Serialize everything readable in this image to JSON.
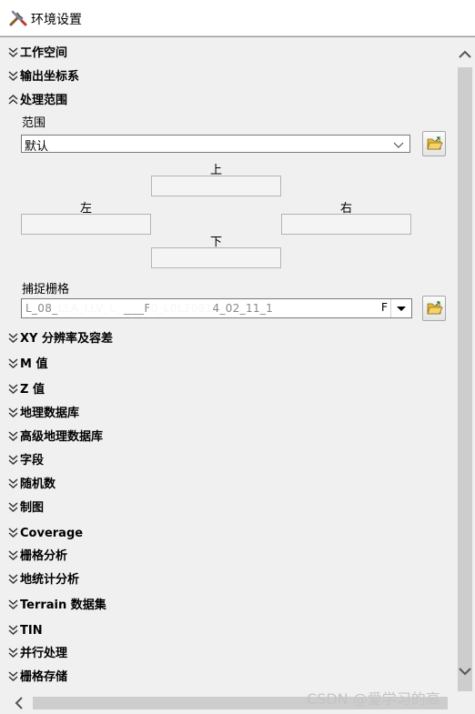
{
  "window": {
    "title": "环境设置"
  },
  "sections_top": [
    {
      "label": "工作空间",
      "expanded": false
    },
    {
      "label": "输出坐标系",
      "expanded": false
    },
    {
      "label": "处理范围",
      "expanded": true
    }
  ],
  "processing_extent": {
    "range_label": "范围",
    "range_value": "默认",
    "top_label": "上",
    "left_label": "左",
    "right_label": "右",
    "bottom_label": "下",
    "top_value": "",
    "left_value": "",
    "right_value": "",
    "bottom_value": "",
    "snap_label": "捕捉栅格",
    "snap_value": "L_08_LLA_LLV_L_____F0_L0L20814_02_11_1",
    "snap_value_suffix": "F"
  },
  "sections_bottom": [
    {
      "label": "XY 分辨率及容差"
    },
    {
      "label": "M 值"
    },
    {
      "label": "Z 值"
    },
    {
      "label": "地理数据库"
    },
    {
      "label": "高级地理数据库"
    },
    {
      "label": "字段"
    },
    {
      "label": "随机数"
    },
    {
      "label": "制图"
    },
    {
      "label": "Coverage"
    },
    {
      "label": "栅格分析"
    },
    {
      "label": "地统计分析"
    },
    {
      "label": "Terrain 数据集"
    },
    {
      "label": "TIN"
    },
    {
      "label": "并行处理"
    },
    {
      "label": "栅格存储"
    }
  ],
  "watermark": "CSDN @爱学习的高",
  "icons": {
    "title": "tools-icon",
    "collapsed": "double-chevron-down-icon",
    "expanded": "double-chevron-up-icon",
    "browse": "folder-open-icon"
  }
}
